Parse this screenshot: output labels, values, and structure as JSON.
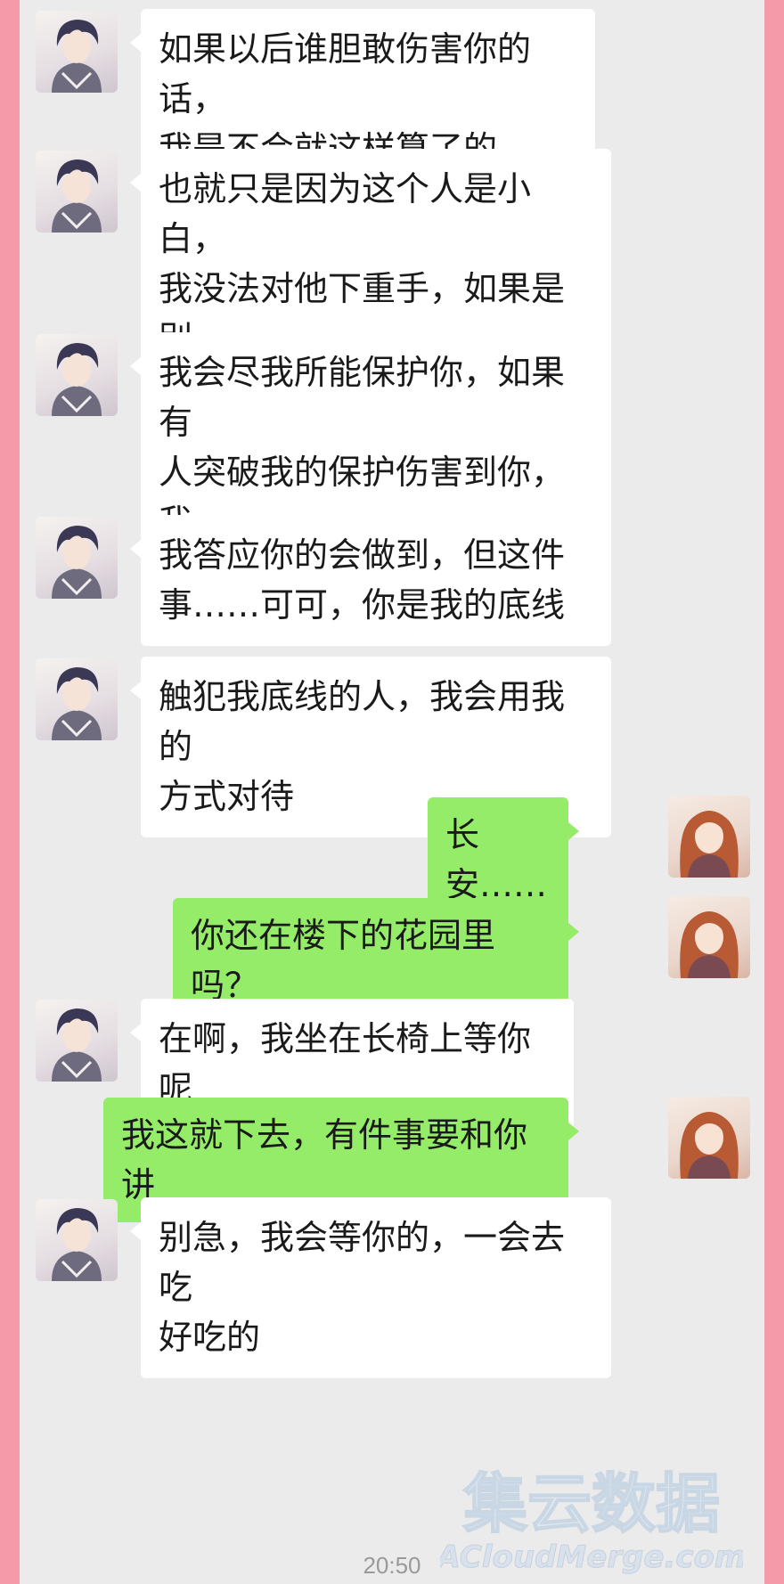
{
  "messages": [
    {
      "sender": "contact",
      "text": "如果以后谁胆敢伤害你的话，\n我是不会就这样算了的"
    },
    {
      "sender": "contact",
      "text": "也就只是因为这个人是小白，\n我没法对他下重手，如果是别\n人，我不能保证后果"
    },
    {
      "sender": "contact",
      "text": "我会尽我所能保护你，如果有\n人突破我的保护伤害到你，我\n不会放过他"
    },
    {
      "sender": "contact",
      "text": "我答应你的会做到，但这件\n事……可可，你是我的底线"
    },
    {
      "sender": "contact",
      "text": "触犯我底线的人，我会用我的\n方式对待"
    },
    {
      "sender": "me",
      "text": "长安……"
    },
    {
      "sender": "me",
      "text": "你还在楼下的花园里吗？"
    },
    {
      "sender": "contact",
      "text": "在啊，我坐在长椅上等你呢"
    },
    {
      "sender": "me",
      "text": "我这就下去，有件事要和你讲"
    },
    {
      "sender": "contact",
      "text": "别急，我会等你的，一会去吃\n好吃的"
    }
  ],
  "timestamp": "20:50",
  "watermark": {
    "title": "集云数据",
    "url": "ACloudMerge.com"
  },
  "avatars": {
    "contact": "male-avatar",
    "me": "female-avatar"
  },
  "colors": {
    "border": "#f49aa8",
    "background": "#ebebeb",
    "incoming": "#ffffff",
    "outgoing": "#95ec69"
  }
}
